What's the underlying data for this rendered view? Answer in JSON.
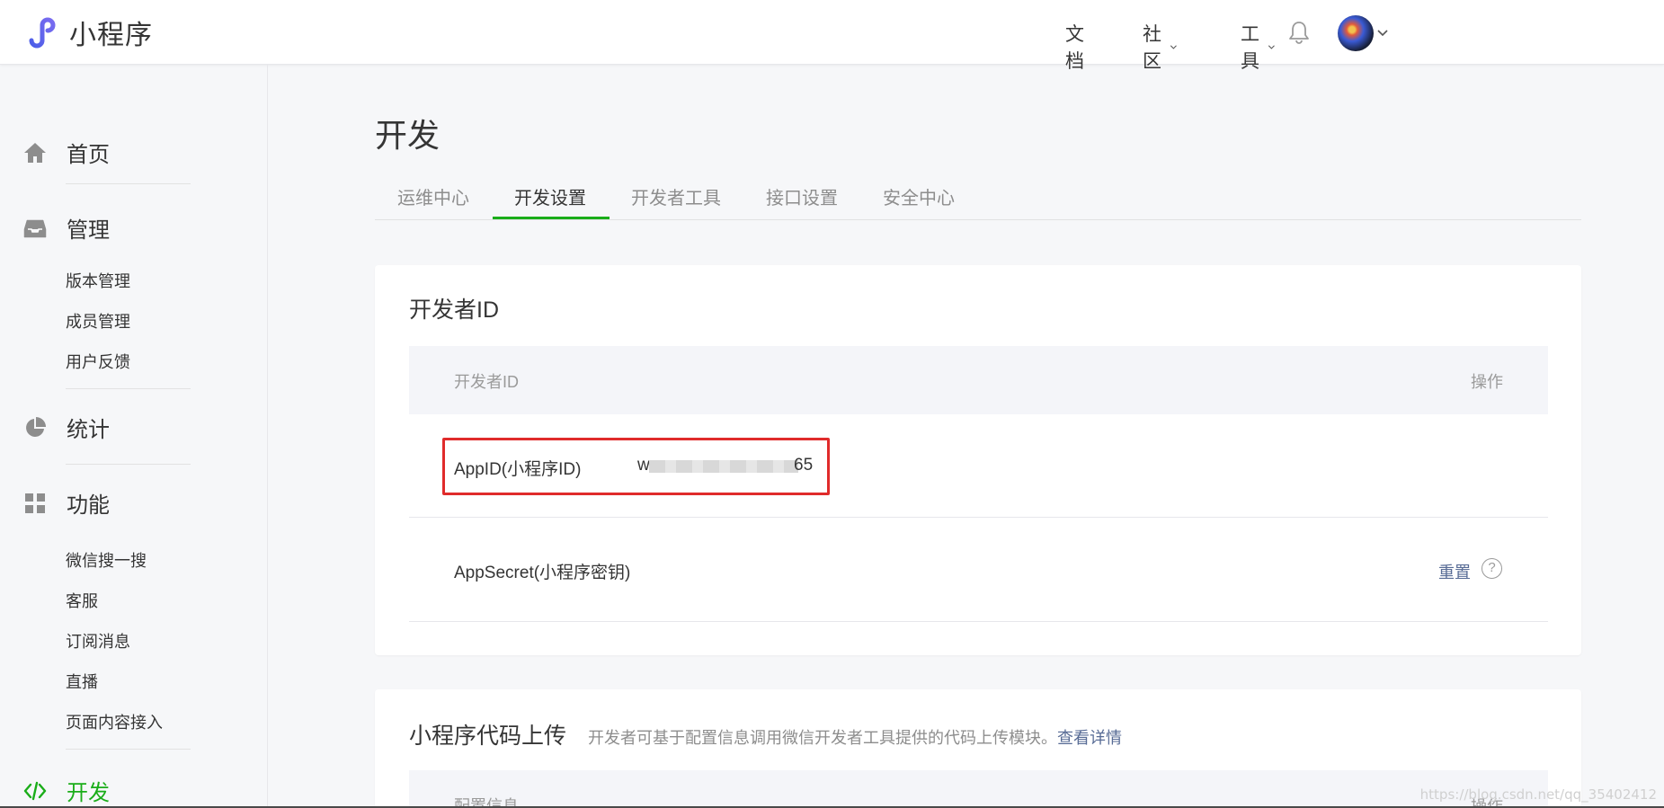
{
  "header": {
    "brand": "小程序",
    "nav": [
      {
        "label": "文档",
        "has_menu": false
      },
      {
        "label": "社区",
        "has_menu": true
      },
      {
        "label": "工具",
        "has_menu": true
      }
    ],
    "bell_icon": "bell-icon",
    "avatar_icon": "user-avatar"
  },
  "sidebar": {
    "sections": [
      {
        "label": "首页",
        "icon": "home-icon"
      },
      {
        "label": "管理",
        "icon": "inbox-icon",
        "items": [
          "版本管理",
          "成员管理",
          "用户反馈"
        ]
      },
      {
        "label": "统计",
        "icon": "pie-chart-icon"
      },
      {
        "label": "功能",
        "icon": "grid-icon",
        "items": [
          "微信搜一搜",
          "客服",
          "订阅消息",
          "直播",
          "页面内容接入"
        ]
      },
      {
        "label": "开发",
        "icon": "code-icon",
        "active": true
      }
    ]
  },
  "main": {
    "title": "开发",
    "tabs": [
      "运维中心",
      "开发设置",
      "开发者工具",
      "接口设置",
      "安全中心"
    ],
    "active_tab": "开发设置",
    "developer_id_card": {
      "title": "开发者ID",
      "columns": {
        "name": "开发者ID",
        "action": "操作"
      },
      "rows": [
        {
          "name": "AppID(小程序ID)",
          "value_prefix": "w",
          "value_suffix": "65"
        },
        {
          "name": "AppSecret(小程序密钥)",
          "action": "重置",
          "help": "?"
        }
      ]
    },
    "upload_card": {
      "title": "小程序代码上传",
      "description": "开发者可基于配置信息调用微信开发者工具提供的代码上传模块。",
      "link": "查看详情",
      "columns": {
        "name": "配置信息",
        "action": "操作"
      }
    }
  },
  "watermark": "https://blog.csdn.net/qq_35402412",
  "colors": {
    "accent_green": "#1aad19",
    "link_blue": "#576b95",
    "highlight_red": "#e02b2b"
  }
}
